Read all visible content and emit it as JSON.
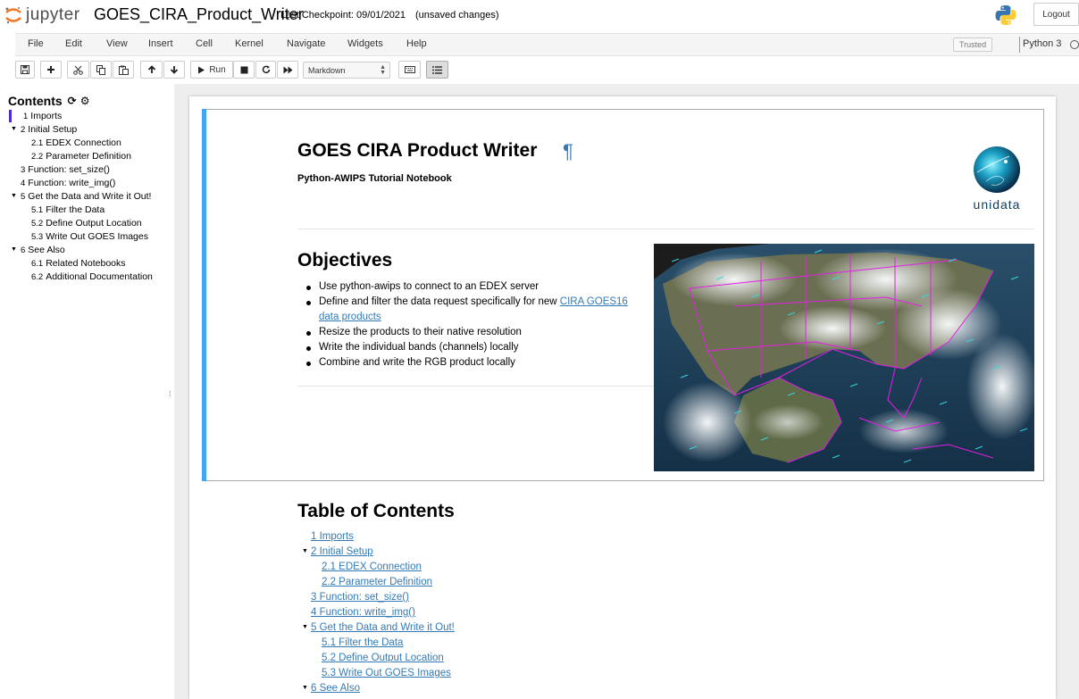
{
  "header": {
    "logo_text": "jupyter",
    "notebook_name": "GOES_CIRA_Product_Writer",
    "checkpoint": "Last Checkpoint: 09/01/2021",
    "unsaved": "(unsaved changes)",
    "logout_label": "Logout"
  },
  "menubar": {
    "items": [
      "File",
      "Edit",
      "View",
      "Insert",
      "Cell",
      "Kernel",
      "Navigate",
      "Widgets",
      "Help"
    ],
    "trusted": "Trusted",
    "kernel": "Python 3"
  },
  "toolbar": {
    "run_label": "Run",
    "cell_type": "Markdown",
    "icons": [
      "save-icon",
      "plus-icon",
      "cut-icon",
      "copy-icon",
      "paste-icon",
      "arrow-up-icon",
      "arrow-down-icon",
      "run-icon",
      "stop-icon",
      "restart-icon",
      "fast-forward-icon",
      "keyboard-icon",
      "list-icon"
    ]
  },
  "toc_sidebar": {
    "title": "Contents",
    "items": [
      {
        "num": "1",
        "label": "Imports"
      },
      {
        "num": "2",
        "label": "Initial Setup"
      },
      {
        "num": "2.1",
        "label": "EDEX Connection"
      },
      {
        "num": "2.2",
        "label": "Parameter Definition"
      },
      {
        "num": "3",
        "label": "Function: set_size()"
      },
      {
        "num": "4",
        "label": "Function: write_img()"
      },
      {
        "num": "5",
        "label": "Get the Data and Write it Out!"
      },
      {
        "num": "5.1",
        "label": "Filter the Data"
      },
      {
        "num": "5.2",
        "label": "Define Output Location"
      },
      {
        "num": "5.3",
        "label": "Write Out GOES Images"
      },
      {
        "num": "6",
        "label": "See Also"
      },
      {
        "num": "6.1",
        "label": "Related Notebooks"
      },
      {
        "num": "6.2",
        "label": "Additional Documentation"
      }
    ]
  },
  "cell1": {
    "title": "GOES CIRA Product Writer",
    "pilcrow": "¶",
    "subtitle": "Python-AWIPS Tutorial Notebook",
    "logo_text": "unidata",
    "objectives_heading": "Objectives",
    "objectives": {
      "o1": "Use python-awips to connect to an EDEX server",
      "o2_pre": "Define and filter the data request specifically for new ",
      "o2_link": "CIRA GOES16 data products",
      "o3": "Resize the products to their native resolution",
      "o4": "Write the individual bands (channels) locally",
      "o5": "Combine and write the RGB product locally"
    }
  },
  "cell2": {
    "heading": "Table of Contents",
    "links": [
      "1  Imports",
      "2  Initial Setup",
      "2.1  EDEX Connection",
      "2.2  Parameter Definition",
      "3  Function: set_size()",
      "4  Function: write_img()",
      "5  Get the Data and Write it Out!",
      "5.1  Filter the Data",
      "5.2  Define Output Location",
      "5.3  Write Out GOES Images",
      "6  See Also"
    ]
  },
  "colors": {
    "accent": "#337ab7",
    "cell_selected_bar": "#42a5f5",
    "toc_active_bar": "#4b2bd1",
    "logo_orange": "#f37726"
  }
}
